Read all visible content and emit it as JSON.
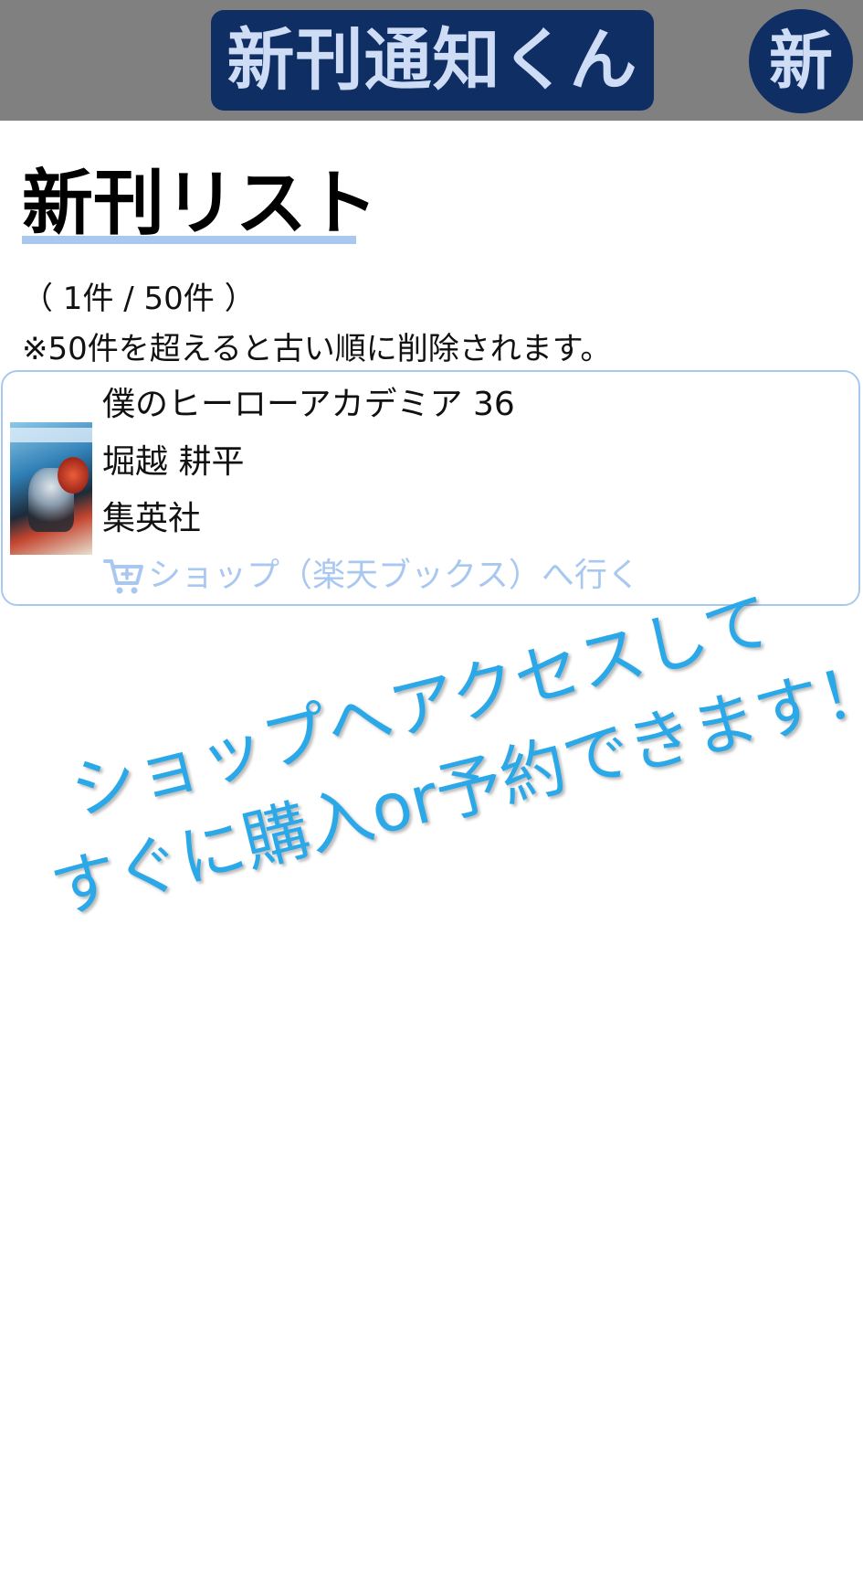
{
  "header": {
    "app_title": "新刊通知くん",
    "new_button_label": "新"
  },
  "main": {
    "page_title": "新刊リスト",
    "count": "（ 1件 / 50件 ）",
    "note": "※50件を超えると古い順に削除されます。"
  },
  "book": {
    "title": "僕のヒーローアカデミア 36",
    "author": "堀越 耕平",
    "publisher": "集英社",
    "shop_link": "ショップ（楽天ブックス）へ行く",
    "shop_icon": "shopping-cart-icon"
  },
  "promo": {
    "line1": "ショップへアクセスして",
    "line2": "すぐに購入or予約できます！！"
  },
  "colors": {
    "header_bg": "#808080",
    "brand_navy": "#0f2e63",
    "accent_light_blue": "#a9c8f0",
    "promo_blue": "#2ba8e8"
  }
}
